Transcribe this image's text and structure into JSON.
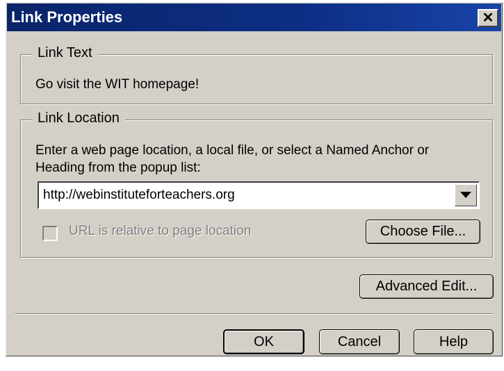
{
  "window": {
    "title": "Link Properties",
    "close_glyph": "✕"
  },
  "link_text": {
    "legend": "Link Text",
    "value": "Go visit the WIT homepage!"
  },
  "link_location": {
    "legend": "Link Location",
    "instruction_line1": "Enter a web page location, a local file, or select a Named Anchor or",
    "instruction_line2": "Heading from the popup list:",
    "url_value": "http://webinstituteforteachers.org",
    "relative_label": "URL is relative to page location",
    "relative_checked": false,
    "choose_file_label": "Choose File..."
  },
  "advanced_edit_label": "Advanced Edit...",
  "footer": {
    "ok_label": "OK",
    "cancel_label": "Cancel",
    "help_label": "Help"
  },
  "colors": {
    "face": "#d4d0c8",
    "title_bar": "#0a246a",
    "disabled_text": "#808080"
  }
}
